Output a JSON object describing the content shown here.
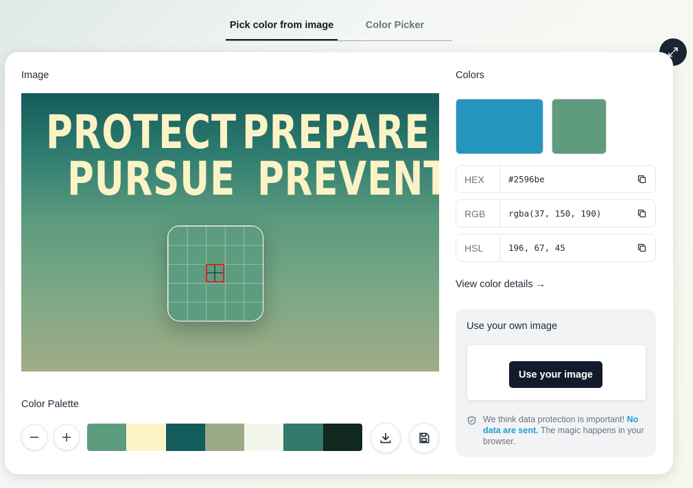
{
  "tabs": [
    {
      "label": "Pick color from image",
      "active": true
    },
    {
      "label": "Color Picker",
      "active": false
    }
  ],
  "image_section": {
    "label": "Image",
    "poster_lines": [
      "PROTECT",
      "PREPARE",
      "PURSUE",
      "PREVENT"
    ]
  },
  "palette_section": {
    "label": "Color Palette",
    "colors": [
      "#5d9c7f",
      "#fcf3c7",
      "#145b5b",
      "#9aaa87",
      "#f3f6ea",
      "#337a6b",
      "#10281e"
    ]
  },
  "colors_section": {
    "label": "Colors",
    "selected_color": "#2596be",
    "picked_color": "#5f9c7e",
    "fields": [
      {
        "label": "HEX",
        "value": "#2596be"
      },
      {
        "label": "RGB",
        "value": "rgba(37, 150, 190)"
      },
      {
        "label": "HSL",
        "value": "196, 67, 45"
      }
    ],
    "details_link": "View color details →"
  },
  "own_image": {
    "title": "Use your own image",
    "button": "Use your image",
    "notice_start": "We think data protection is important!",
    "notice_highlight": "No data are sent.",
    "notice_end": "The magic happens in your browser."
  },
  "icons": {
    "expand": "expand-icon",
    "minus": "minus-icon",
    "plus": "plus-icon",
    "download": "download-icon",
    "save": "save-icon",
    "copy": "copy-icon",
    "shield": "shield-check-icon"
  },
  "accent": {
    "link": "#1ea0d0",
    "dark_button": "#121a2b"
  }
}
